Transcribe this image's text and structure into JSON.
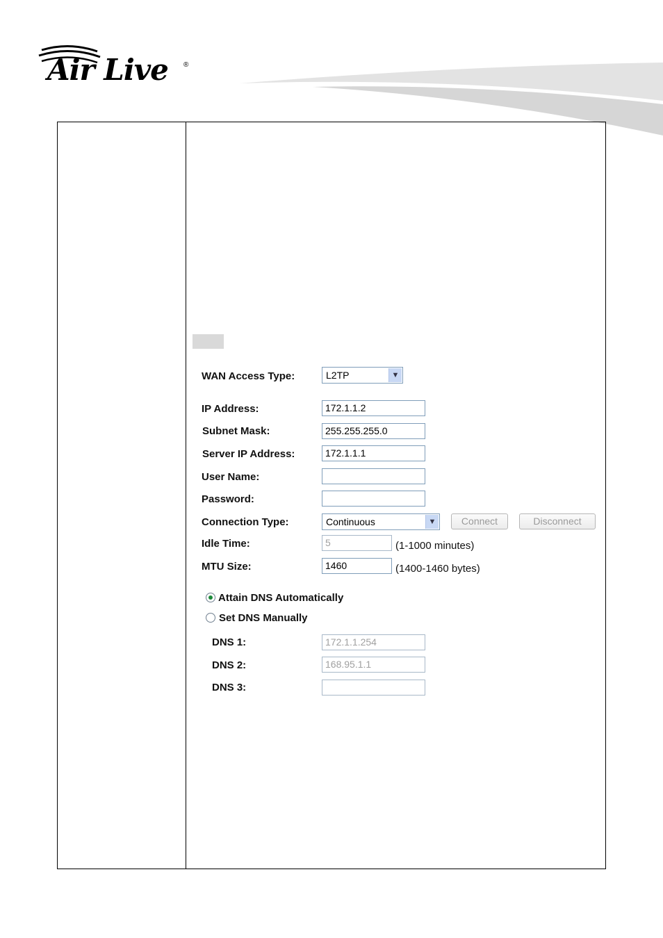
{
  "logo": {
    "brand": "Air Live",
    "registered": "®"
  },
  "form": {
    "wan_access_type": {
      "label": "WAN Access Type:",
      "value": "L2TP"
    },
    "ip_address": {
      "label": "IP Address:",
      "value": "172.1.1.2"
    },
    "subnet_mask": {
      "label": "Subnet Mask:",
      "value": "255.255.255.0"
    },
    "server_ip": {
      "label": "Server IP Address:",
      "value": "172.1.1.1"
    },
    "user_name": {
      "label": "User Name:",
      "value": ""
    },
    "password": {
      "label": "Password:",
      "value": ""
    },
    "connection_type": {
      "label": "Connection Type:",
      "value": "Continuous"
    },
    "connect_button": "Connect",
    "disconnect_button": "Disconnect",
    "idle_time": {
      "label": "Idle Time:",
      "value": "5",
      "hint": "(1-1000 minutes)"
    },
    "mtu_size": {
      "label": "MTU Size:",
      "value": "1460",
      "hint": "(1400-1460 bytes)"
    },
    "dns_auto": {
      "label": "Attain DNS Automatically",
      "checked": true
    },
    "dns_manual": {
      "label": "Set DNS Manually",
      "checked": false
    },
    "dns1": {
      "label": "DNS 1:",
      "value": "172.1.1.254"
    },
    "dns2": {
      "label": "DNS 2:",
      "value": "168.95.1.1"
    },
    "dns3": {
      "label": "DNS 3:",
      "value": ""
    }
  },
  "colors": {
    "accent_radio": "#1d8a3a",
    "field_border": "#7f9db9",
    "swoosh": "#d8d8d8"
  }
}
